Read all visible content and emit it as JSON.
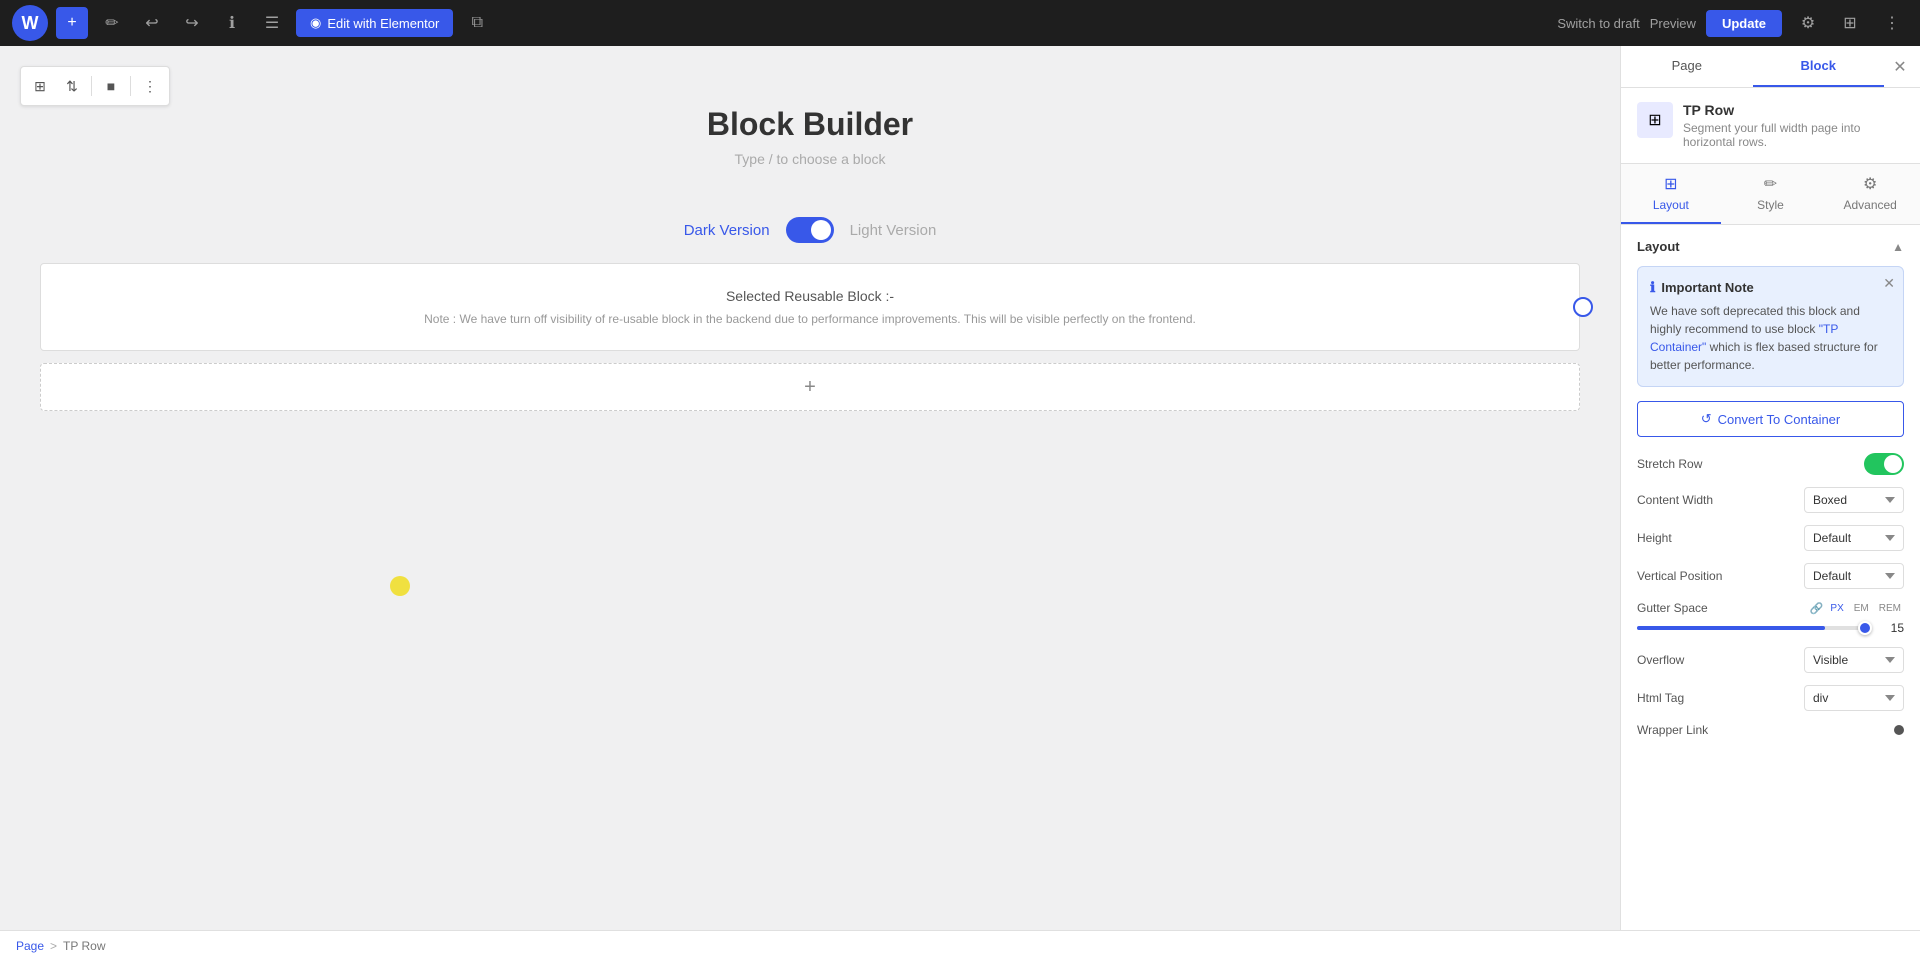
{
  "topbar": {
    "add_btn": "+",
    "edit_btn": "✏",
    "undo_btn": "↩",
    "redo_btn": "↪",
    "info_btn": "ℹ",
    "list_btn": "☰",
    "edit_with_elementor_label": "Edit with Elementor",
    "copy_btn": "⧉",
    "switch_draft_label": "Switch to draft",
    "preview_label": "Preview",
    "update_label": "Update",
    "gear_btn": "⚙",
    "grid_btn": "⊞",
    "more_btn": "⋮"
  },
  "content": {
    "page_title": "Block Builder",
    "page_subtitle": "Type / to choose a block",
    "toggle_dark": "Dark Version",
    "toggle_light": "Light Version",
    "reusable_block_title": "Selected Reusable Block :-",
    "reusable_block_note": "Note : We have turn off visibility of re-usable block in the backend due to performance improvements. This will be visible perfectly on the frontend.",
    "add_block_icon": "+"
  },
  "right_panel": {
    "tab_page": "Page",
    "tab_block": "Block",
    "block_icon": "⊞",
    "block_name": "TP Row",
    "block_description": "Segment your full width page into horizontal rows.",
    "sub_tab_layout": "Layout",
    "sub_tab_style": "Style",
    "sub_tab_advanced": "Advanced",
    "layout_section_title": "Layout",
    "important_note_title": "Important Note",
    "important_note_text_1": "We have soft deprecated this block and highly recommend to use block ",
    "important_note_highlight": "\"TP Container\"",
    "important_note_text_2": " which is flex based structure for better performance.",
    "convert_btn_label": "Convert To Container",
    "stretch_row_label": "Stretch Row",
    "content_width_label": "Content Width",
    "content_width_value": "Boxed",
    "height_label": "Height",
    "height_value": "Default",
    "vertical_position_label": "Vertical Position",
    "vertical_position_value": "Default",
    "gutter_space_label": "Gutter Space",
    "gutter_unit_px": "PX",
    "gutter_unit_em": "EM",
    "gutter_unit_rem": "REM",
    "gutter_value": "15",
    "overflow_label": "Overflow",
    "overflow_value": "Visible",
    "html_tag_label": "Html Tag",
    "html_tag_value": "div",
    "wrapper_link_label": "Wrapper Link"
  },
  "breadcrumb": {
    "page_label": "Page",
    "separator": ">",
    "current": "TP Row"
  }
}
